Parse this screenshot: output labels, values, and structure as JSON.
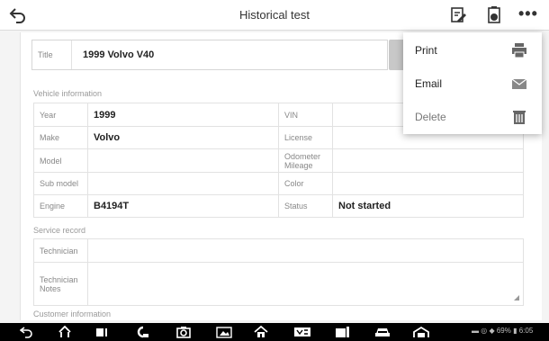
{
  "topbar": {
    "title": "Historical test",
    "more_label": "•••"
  },
  "form": {
    "title_label": "Title",
    "title_value": "1999 Volvo V40",
    "vehicle_section": "Vehicle information",
    "vehicle_rows": [
      {
        "l_label": "Year",
        "l_value": "1999",
        "r_label": "VIN",
        "r_value": ""
      },
      {
        "l_label": "Make",
        "l_value": "Volvo",
        "r_label": "License",
        "r_value": ""
      },
      {
        "l_label": "Model",
        "l_value": "",
        "r_label": "Odometer Mileage",
        "r_value": ""
      },
      {
        "l_label": "Sub model",
        "l_value": "",
        "r_label": "Color",
        "r_value": ""
      },
      {
        "l_label": "Engine",
        "l_value": "B4194T",
        "r_label": "Status",
        "r_value": "Not started"
      }
    ],
    "service_section": "Service record",
    "technician_label": "Technician",
    "technician_value": "",
    "notes_label": "Technician Notes",
    "notes_value": "",
    "customer_section": "Customer information"
  },
  "menu": {
    "items": [
      {
        "label": "Print",
        "icon": "printer-icon"
      },
      {
        "label": "Email",
        "icon": "envelope-icon"
      },
      {
        "label": "Delete",
        "icon": "trash-icon"
      }
    ]
  },
  "navbar": {
    "status_text": "69% 6:05",
    "battery_percent": "69%",
    "time": "6:05"
  }
}
